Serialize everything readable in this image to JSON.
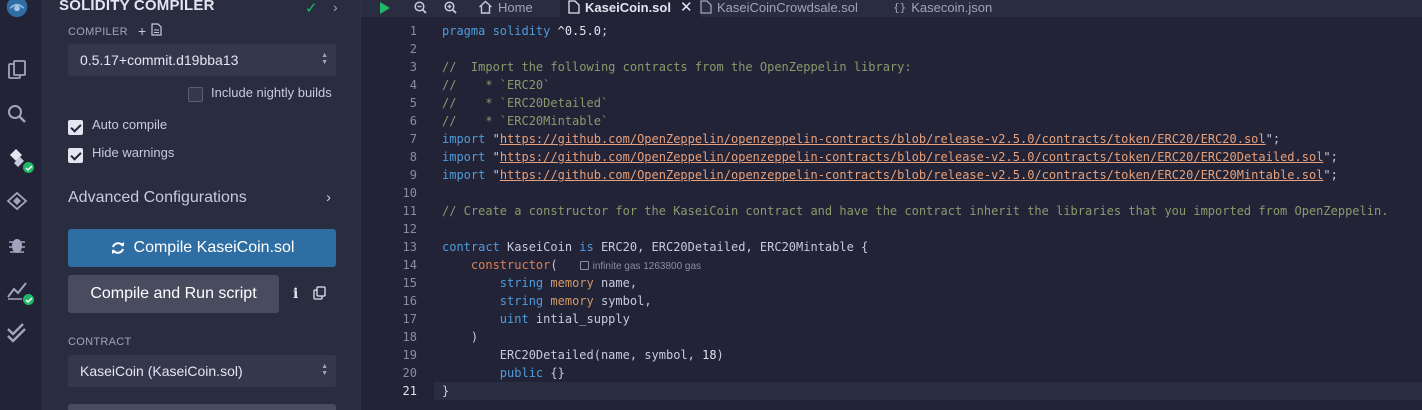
{
  "panel": {
    "title": "SOLIDITY COMPILER",
    "compiler_label": "COMPILER",
    "compiler_version": "0.5.17+commit.d19bba13",
    "nightly_label": "Include nightly builds",
    "auto_compile_label": "Auto compile",
    "hide_warnings_label": "Hide warnings",
    "advanced_label": "Advanced Configurations",
    "compile_button": "Compile KaseiCoin.sol",
    "compile_run_button": "Compile and Run script",
    "contract_label": "CONTRACT",
    "contract_value": "KaseiCoin (KaseiCoin.sol)"
  },
  "checkboxes": {
    "nightly": false,
    "auto_compile": true,
    "hide_warnings": true
  },
  "tabs": [
    {
      "label": "Home",
      "icon": "home-icon"
    },
    {
      "label": "KaseiCoin.sol",
      "icon": "file-icon",
      "active": true
    },
    {
      "label": "KaseiCoinCrowdsale.sol",
      "icon": "file-icon"
    },
    {
      "label": "Kasecoin.json",
      "icon": "braces-icon"
    }
  ],
  "editor": {
    "current_line": 21,
    "gas_hint": "infinite gas 1263800 gas",
    "lines": [
      {
        "n": "1",
        "text": "pragma solidity ^0.5.0;"
      },
      {
        "n": "2",
        "text": ""
      },
      {
        "n": "3",
        "text": "//  Import the following contracts from the OpenZeppelin library:"
      },
      {
        "n": "4",
        "text": "//    * `ERC20`"
      },
      {
        "n": "5",
        "text": "//    * `ERC20Detailed`"
      },
      {
        "n": "6",
        "text": "//    * `ERC20Mintable`"
      },
      {
        "n": "7",
        "text": "import \"https://github.com/OpenZeppelin/openzeppelin-contracts/blob/release-v2.5.0/contracts/token/ERC20/ERC20.sol\";"
      },
      {
        "n": "8",
        "text": "import \"https://github.com/OpenZeppelin/openzeppelin-contracts/blob/release-v2.5.0/contracts/token/ERC20/ERC20Detailed.sol\";"
      },
      {
        "n": "9",
        "text": "import \"https://github.com/OpenZeppelin/openzeppelin-contracts/blob/release-v2.5.0/contracts/token/ERC20/ERC20Mintable.sol\";"
      },
      {
        "n": "10",
        "text": ""
      },
      {
        "n": "11",
        "text": "// Create a constructor for the KaseiCoin contract and have the contract inherit the libraries that you imported from OpenZeppelin."
      },
      {
        "n": "12",
        "text": ""
      },
      {
        "n": "13",
        "text": "contract KaseiCoin is ERC20, ERC20Detailed, ERC20Mintable {"
      },
      {
        "n": "14",
        "text": "    constructor("
      },
      {
        "n": "15",
        "text": "        string memory name,"
      },
      {
        "n": "16",
        "text": "        string memory symbol,"
      },
      {
        "n": "17",
        "text": "        uint intial_supply"
      },
      {
        "n": "18",
        "text": "    )"
      },
      {
        "n": "19",
        "text": "        ERC20Detailed(name, symbol, 18)"
      },
      {
        "n": "20",
        "text": "        public {}"
      },
      {
        "n": "21",
        "text": "}"
      }
    ]
  }
}
